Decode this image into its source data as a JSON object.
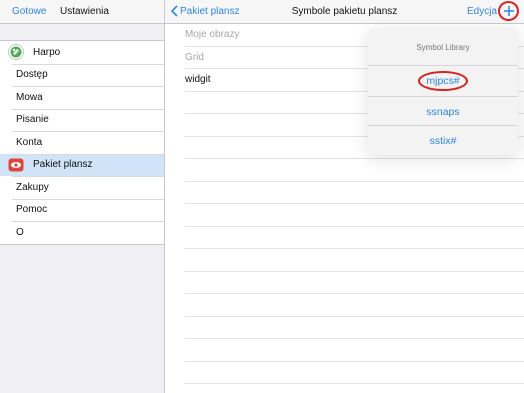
{
  "left_nav": {
    "done_label": "Gotowe",
    "title": "Ustawienia"
  },
  "menu": [
    {
      "label": "Harpo",
      "icon": "harpo-logo-icon"
    },
    {
      "label": "Dostęp"
    },
    {
      "label": "Mowa"
    },
    {
      "label": "Pisanie"
    },
    {
      "label": "Konta"
    },
    {
      "label": "Pakiet plansz",
      "icon": "symbol-pack-icon",
      "selected": true
    },
    {
      "label": "Zakupy"
    },
    {
      "label": "Pomoc"
    },
    {
      "label": "O"
    }
  ],
  "right_nav": {
    "back_label": "Pakiet plansz",
    "title": "Symbole pakietu plansz",
    "edit_label": "Edycja"
  },
  "rows": [
    "Moje obrazy",
    "Grid",
    "widgit"
  ],
  "popover": {
    "title": "Symbol Library",
    "items": [
      "mjpcs#",
      "ssnaps",
      "sstix#"
    ]
  },
  "colors": {
    "accent": "#2d86e2",
    "highlight": "#d8231f",
    "selected_bg": "#d0e3f7"
  }
}
